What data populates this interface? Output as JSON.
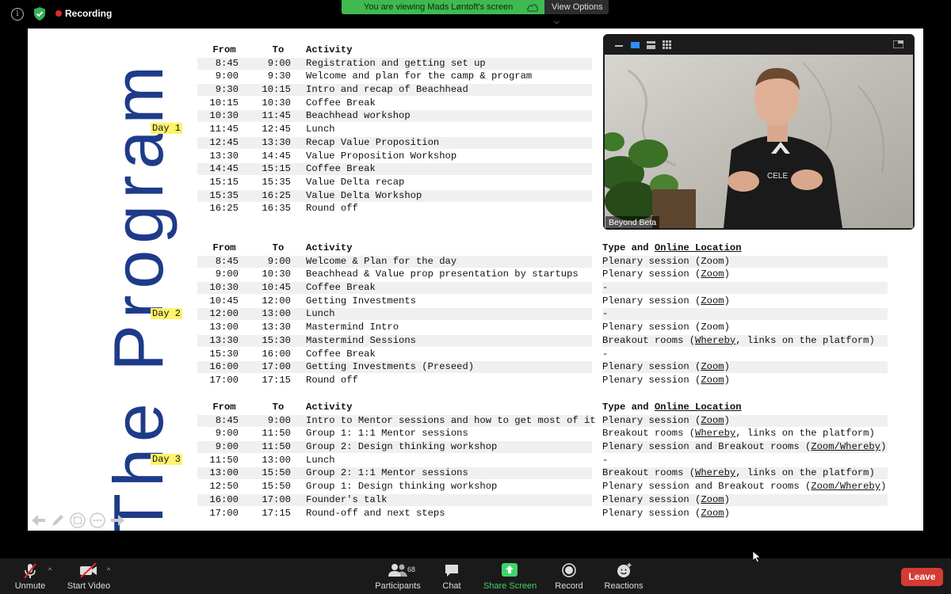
{
  "topbar": {
    "recording_label": "Recording",
    "viewing_banner": "You are viewing Mads Løntoft's screen",
    "view_options": "View Options",
    "accent_green": "#3fb950",
    "rec_color": "#e02828"
  },
  "slide": {
    "vertical_title": "The Program",
    "title_color": "#1e3b8a",
    "header": {
      "from": "From",
      "to": "To",
      "activity": "Activity",
      "type_prefix": "Type and",
      "type_location": "Online Location"
    },
    "days": [
      {
        "label": "Day 1",
        "rows": [
          [
            "8:45",
            "9:00",
            "Registration and getting set up"
          ],
          [
            "9:00",
            "9:30",
            "Welcome and plan for the camp & program"
          ],
          [
            "9:30",
            "10:15",
            "Intro and recap of Beachhead"
          ],
          [
            "10:15",
            "10:30",
            "Coffee Break"
          ],
          [
            "10:30",
            "11:45",
            "Beachhead workshop"
          ],
          [
            "11:45",
            "12:45",
            "Lunch"
          ],
          [
            "12:45",
            "13:30",
            "Recap Value Proposition"
          ],
          [
            "13:30",
            "14:45",
            "Value Proposition Workshop"
          ],
          [
            "14:45",
            "15:15",
            "Coffee Break"
          ],
          [
            "15:15",
            "15:35",
            "Value Delta recap"
          ],
          [
            "15:35",
            "16:25",
            "Value Delta Workshop"
          ],
          [
            "16:25",
            "16:35",
            "Round off"
          ]
        ]
      },
      {
        "label": "Day 2",
        "rows": [
          [
            "8:45",
            "9:00",
            "Welcome & Plan for the day",
            "Plenary session (Zoom)"
          ],
          [
            "9:00",
            "10:30",
            "Beachhead & Value prop presentation by startups",
            "Plenary session (Zoom)"
          ],
          [
            "10:30",
            "10:45",
            "Coffee Break",
            "-"
          ],
          [
            "10:45",
            "12:00",
            "Getting Investments",
            "Plenary session (Zoom)"
          ],
          [
            "12:00",
            "13:00",
            "Lunch",
            "-"
          ],
          [
            "13:00",
            "13:30",
            "Mastermind Intro",
            "Plenary session (Zoom)"
          ],
          [
            "13:30",
            "15:30",
            "Mastermind Sessions",
            "Breakout rooms (Whereby, links on the platform)"
          ],
          [
            "15:30",
            "16:00",
            "Coffee Break",
            "-"
          ],
          [
            "16:00",
            "17:00",
            "Getting Investments (Preseed)",
            "Plenary session (Zoom)"
          ],
          [
            "17:00",
            "17:15",
            "Round off",
            "Plenary session (Zoom)"
          ]
        ]
      },
      {
        "label": "Day 3",
        "rows": [
          [
            "8:45",
            "9:00",
            "Intro to Mentor sessions and how to get most of it",
            "Plenary session (Zoom)"
          ],
          [
            "9:00",
            "11:50",
            "Group 1: 1:1 Mentor sessions",
            "Breakout rooms (Whereby, links on the platform)"
          ],
          [
            "9:00",
            "11:50",
            "Group 2: Design thinking workshop",
            "Plenary session and Breakout rooms (Zoom/Whereby)"
          ],
          [
            "11:50",
            "13:00",
            "Lunch",
            "-"
          ],
          [
            "13:00",
            "15:50",
            "Group 2: 1:1 Mentor sessions",
            "Breakout rooms (Whereby, links on the platform)"
          ],
          [
            "12:50",
            "15:50",
            "Group 1: Design thinking workshop",
            "Plenary session and Breakout rooms (Zoom/Whereby)"
          ],
          [
            "16:00",
            "17:00",
            "Founder's talk",
            "Plenary session (Zoom)"
          ],
          [
            "17:00",
            "17:15",
            "Round-off and next steps",
            "Plenary session (Zoom)"
          ]
        ]
      }
    ]
  },
  "video": {
    "participant_name": "Beyond Beta",
    "shirt_text": "CELE"
  },
  "toolbar": {
    "unmute": "Unmute",
    "start_video": "Start Video",
    "participants": "Participants",
    "participants_count": "68",
    "chat": "Chat",
    "share_screen": "Share Screen",
    "record": "Record",
    "reactions": "Reactions",
    "leave": "Leave",
    "leave_color": "#d33b33",
    "share_color": "#3fd56a"
  }
}
